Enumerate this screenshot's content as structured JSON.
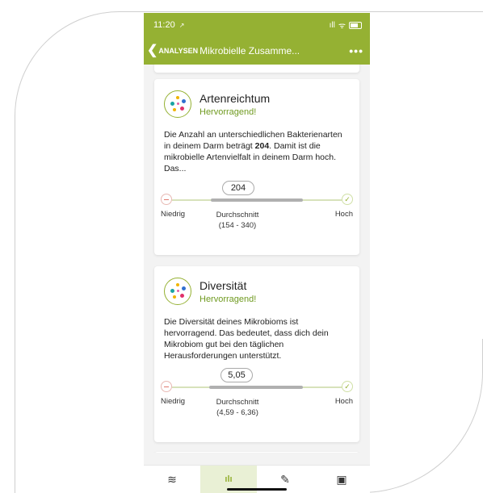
{
  "status_bar": {
    "time": "11:20",
    "location_arrow": "↗",
    "signal": "ıll",
    "wifi": "ᯤ"
  },
  "nav": {
    "back_label": "ANALYSEN",
    "back_chevron": "❮",
    "title": "Mikrobielle Zusamme...",
    "more": "•••"
  },
  "cards": [
    {
      "title": "Artenreichtum",
      "rating": "Hervorragend!",
      "desc_pre": "Die Anzahl an unterschiedlichen Bakterienarten in deinem Darm beträgt ",
      "desc_bold": "204",
      "desc_post": ". Damit ist die mikrobielle Artenvielfalt in deinem Darm hoch. Das...",
      "value": "204",
      "low_label": "Niedrig",
      "avg_label": "Durchschnitt",
      "avg_range": "(154 - 340)",
      "high_label": "Hoch"
    },
    {
      "title": "Diversität",
      "rating": "Hervorragend!",
      "desc_pre": "Die Diversität deines Mikrobioms ist hervorragend. Das bedeutet, dass dich dein Mikrobiom gut bei den täglichen Herausforderungen unterstützt.",
      "desc_bold": "",
      "desc_post": "",
      "value": "5,05",
      "low_label": "Niedrig",
      "avg_label": "Durchschnitt",
      "avg_range": "(4,59 - 6,36)",
      "high_label": "Hoch"
    }
  ],
  "meter_icons": {
    "low": "minus-icon",
    "high": "check-icon",
    "check_glyph": "✓"
  },
  "tabs": [
    {
      "name": "layers-icon",
      "glyph": "≋",
      "active": false
    },
    {
      "name": "bar-chart-icon",
      "glyph": "ılı",
      "active": true
    },
    {
      "name": "pen-icon",
      "glyph": "✎",
      "active": false
    },
    {
      "name": "kit-icon",
      "glyph": "▣",
      "active": false
    }
  ],
  "colors": {
    "brand": "#95b133",
    "rating": "#6f9a1f"
  }
}
